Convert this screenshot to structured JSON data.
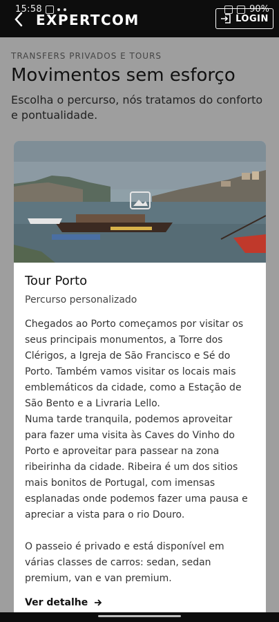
{
  "status": {
    "time": "15:58",
    "battery": "90%"
  },
  "header": {
    "brand": "EXPERTCOM",
    "login_label": "LOGIN"
  },
  "page": {
    "eyebrow": "TRANSFERS PRIVADOS E TOURS",
    "title": "Movimentos sem esforço",
    "subtitle": "Escolha o percurso, nós tratamos do conforto e pontualidade."
  },
  "card": {
    "title": "Tour Porto",
    "subtitle": "Percurso personalizado",
    "paragraph1": "Chegados ao Porto começamos por visitar os seus principais monumentos, a Torre dos Clérigos, a Igreja de São Francisco e Sé do Porto. Também vamos visitar os locais mais emblemáticos da cidade, como a Estação de São Bento e a Livraria Lello.",
    "paragraph2": "Numa tarde tranquila, podemos aproveitar para fazer uma visita às Caves do Vinho do Porto e aproveitar para passear na zona ribeirinha da cidade. Ribeira é um dos sitios mais bonitos de Portugal, com imensas esplanadas onde podemos fazer uma pausa e apreciar a vista para o rio Douro.",
    "paragraph3": "O passeio é privado e está disponível em várias classes de carros: sedan, sedan premium, van e van premium.",
    "link_label": "Ver detalhe"
  },
  "colors": {
    "topbar": "#0d0d0d",
    "page_bg": "#9e9e9e",
    "card_bg": "#ffffff",
    "river": "#5f7680",
    "boat_red": "#c0392b"
  }
}
